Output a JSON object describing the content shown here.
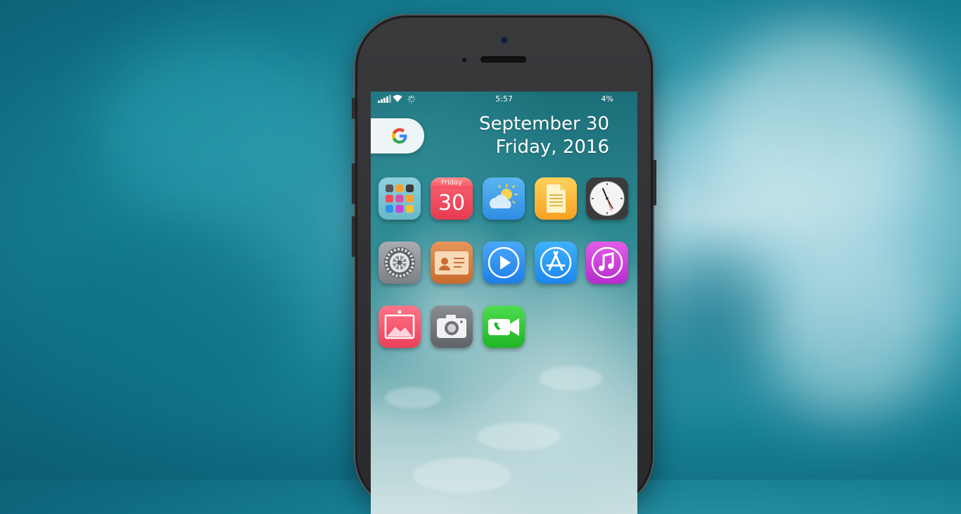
{
  "status_bar": {
    "time": "5:57",
    "battery_percent": "4%"
  },
  "date_widget": {
    "date": "September 30",
    "day_year": "Friday, 2016"
  },
  "calendar_icon": {
    "weekday": "Friday",
    "day": "30"
  },
  "google_widget": {
    "letter": "G"
  },
  "icons": [
    {
      "name": "folder-icon",
      "color": "#7fc6d3"
    },
    {
      "name": "calendar-icon",
      "color": "#f0485a"
    },
    {
      "name": "weather-icon",
      "color": "#3aa0e9"
    },
    {
      "name": "notes-icon",
      "color": "#fbb52e"
    },
    {
      "name": "clock-icon",
      "color": "#3b3b3d"
    },
    {
      "name": "settings-icon",
      "color": "#8a8e93"
    },
    {
      "name": "contacts-icon",
      "color": "#d98142"
    },
    {
      "name": "videos-icon",
      "color": "#2d8ff0"
    },
    {
      "name": "app-store-icon",
      "color": "#2a9df4"
    },
    {
      "name": "itunes-icon",
      "color": "#d13ed9"
    },
    {
      "name": "photos-icon",
      "color": "#f2566f"
    },
    {
      "name": "camera-icon",
      "color": "#6f7276"
    },
    {
      "name": "facetime-icon",
      "color": "#34c93b"
    }
  ]
}
